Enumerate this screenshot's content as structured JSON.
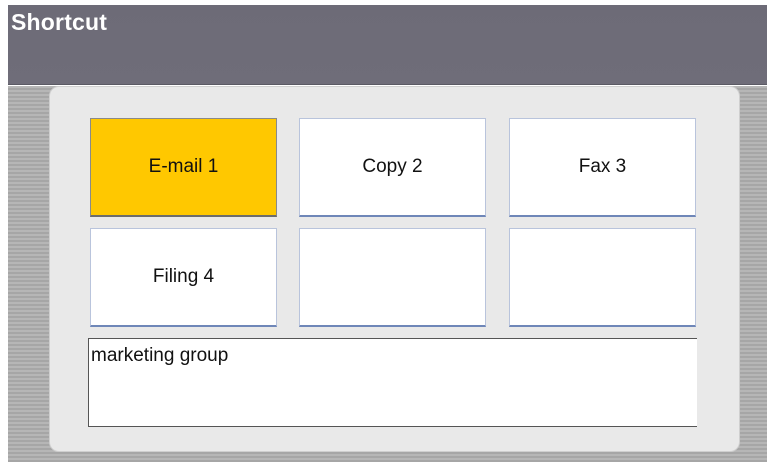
{
  "header": {
    "title": "Shortcut"
  },
  "shortcuts": [
    {
      "label": "E-mail 1",
      "selected": true
    },
    {
      "label": "Copy 2",
      "selected": false
    },
    {
      "label": "Fax 3",
      "selected": false
    },
    {
      "label": "Filing 4",
      "selected": false
    },
    {
      "label": "",
      "selected": false
    },
    {
      "label": "",
      "selected": false
    }
  ],
  "memo": {
    "text": "marketing group"
  },
  "colors": {
    "title_bar": "#6f6d79",
    "selected_key": "#ffc800",
    "panel": "#e9e9e9",
    "key_border_bottom": "#6f87b8"
  }
}
